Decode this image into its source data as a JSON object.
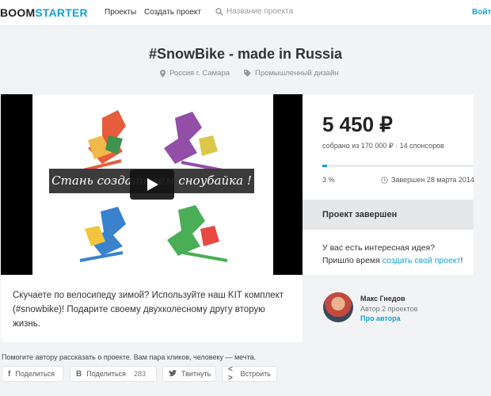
{
  "header": {
    "logo_part1": "BOOM",
    "logo_part2": "STARTER",
    "nav": [
      "Проекты",
      "Создать проект"
    ],
    "search_placeholder": "Название проекта",
    "login": "Войти"
  },
  "project": {
    "title": "#SnowBike - made in Russia",
    "location": "Россия г. Самара",
    "category": "Промышленный дизайн",
    "video_banner": "Стань создателем сноубайка !",
    "description": "Скучаете по велосипеду зимой? Используйте наш KIT комплект (#snowbike)! Подарите своему двухколесному другу вторую жизнь."
  },
  "funding": {
    "amount": "5 450 ₽",
    "collected": "собрано из 170 000 ₽ · 14 спонсоров",
    "percent": "3 %",
    "progress_fraction": 0.03,
    "ended": "Завершен 28 марта 2014",
    "status": "Проект завершен",
    "idea_line1": "У вас есть интересная идея?",
    "idea_line2_prefix": "Пришло время ",
    "idea_link": "создать свой проект",
    "idea_line2_suffix": "!"
  },
  "author": {
    "name": "Макс Гнедов",
    "role": "Автор 2 проектов",
    "link": "Про автора"
  },
  "share": {
    "hint": "Помогите автору рассказать о проекте. Вам пара кликов, человеку — мечта.",
    "facebook": "Поделиться",
    "vk": "Поделиться",
    "vk_count": "283",
    "twitter": "Твитнуть",
    "embed": "Встроить"
  },
  "colors": {
    "accent": "#11a3d6",
    "background": "#f1f3f5",
    "status_box": "#e5e7e9"
  },
  "icons": [
    "search-icon",
    "location-icon",
    "tag-icon",
    "clock-icon",
    "play-icon",
    "facebook-icon",
    "vk-icon",
    "twitter-icon",
    "embed-icon"
  ]
}
